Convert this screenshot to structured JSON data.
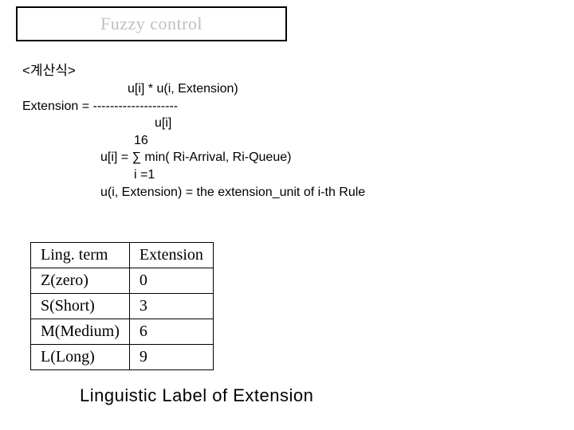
{
  "title": "Fuzzy control",
  "formula": {
    "heading": "<계산식>",
    "num": "u[i] * u(i, Extension)",
    "lhs": "Extension = --------------------",
    "den": "u[i]",
    "sum_upper": "16",
    "sum_expr": "u[i] = ∑ min( Ri-Arrival, Ri-Queue)",
    "sum_lower": "i =1",
    "def": "u(i, Extension) = the extension_unit of i-th Rule"
  },
  "chart_data": {
    "type": "table",
    "headers": [
      "Ling. term",
      "Extension"
    ],
    "rows": [
      [
        "Z(zero)",
        "0"
      ],
      [
        "S(Short)",
        "3"
      ],
      [
        "M(Medium)",
        "6"
      ],
      [
        "L(Long)",
        "9"
      ]
    ]
  },
  "caption": "Linguistic Label of Extension"
}
